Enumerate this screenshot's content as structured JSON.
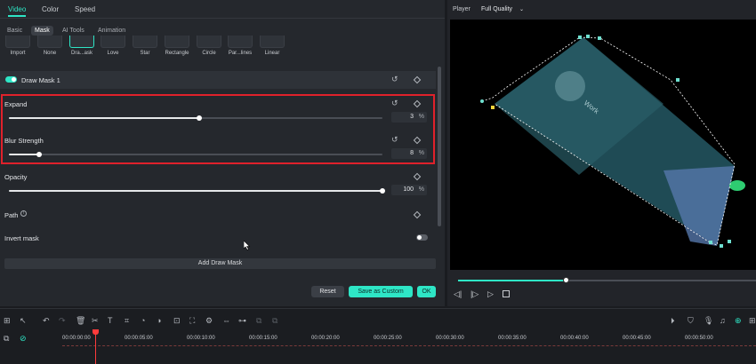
{
  "tabs": [
    {
      "label": "Video",
      "active": true
    },
    {
      "label": "Color",
      "active": false
    },
    {
      "label": "Speed",
      "active": false
    }
  ],
  "subtabs": [
    {
      "label": "Basic",
      "active": false
    },
    {
      "label": "Mask",
      "active": true
    },
    {
      "label": "AI Tools",
      "active": false
    },
    {
      "label": "Animation",
      "active": false
    }
  ],
  "presets": [
    "Import",
    "None",
    "Dra...ask",
    "Love",
    "Star",
    "Rectangle",
    "Circle",
    "Par...lines",
    "Linear"
  ],
  "mask": {
    "title": "Draw Mask 1",
    "expand": {
      "label": "Expand",
      "value": "3",
      "unit": "%",
      "fraction": 0.51
    },
    "blur": {
      "label": "Blur Strength",
      "value": "8",
      "unit": "%",
      "fraction": 0.08
    },
    "opacity": {
      "label": "Opacity",
      "value": "100",
      "unit": "%",
      "fraction": 1.0
    },
    "path_label": "Path",
    "invert_label": "Invert mask",
    "add_button": "Add Draw Mask"
  },
  "actions": {
    "reset": "Reset",
    "save_custom": "Save as Custom",
    "ok": "OK"
  },
  "player": {
    "label": "Player",
    "quality": "Full Quality",
    "progress": 0.36,
    "video_text": "Work"
  },
  "timeline": {
    "timecodes": [
      "00:00:00:00",
      "00:00:05:00",
      "00:00:10:00",
      "00:00:15:00",
      "00:00:20:00",
      "00:00:25:00",
      "00:00:30:00",
      "00:00:35:00",
      "00:00:40:00",
      "00:00:45:00",
      "00:00:50:00"
    ]
  },
  "colors": {
    "accent": "#2ee6c6",
    "highlight": "#e0212b",
    "playhead": "#ff3b3b"
  }
}
